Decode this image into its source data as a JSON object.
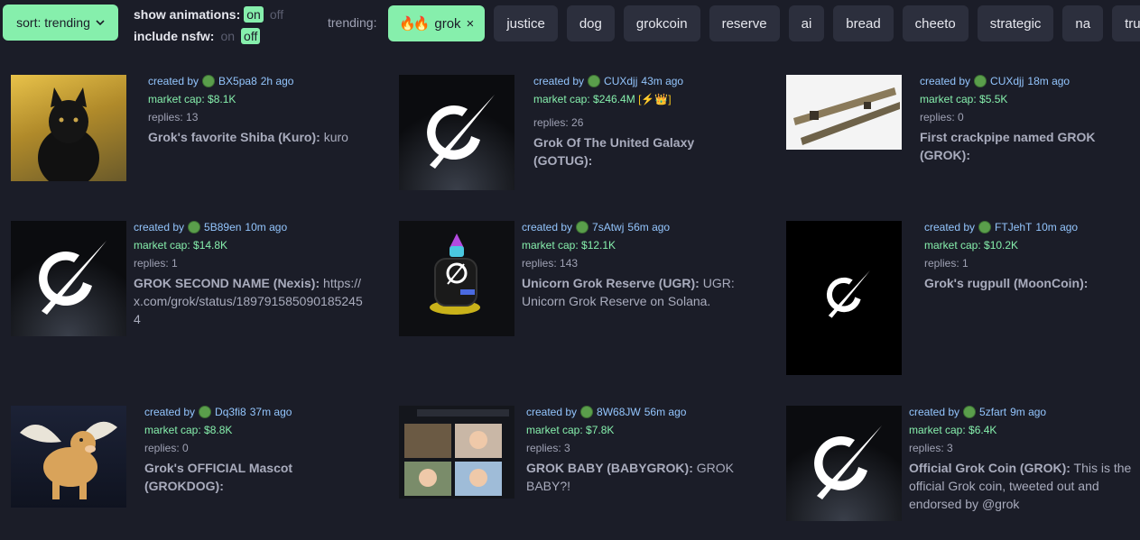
{
  "sort": {
    "label": "sort: trending"
  },
  "toggles": {
    "animations": {
      "label": "show animations:",
      "on": "on",
      "off": "off"
    },
    "nsfw": {
      "label": "include nsfw:",
      "on": "on",
      "off": "off"
    }
  },
  "trending": {
    "label": "trending:",
    "active": {
      "label": "grok",
      "close": "×"
    },
    "chips": [
      "justice",
      "dog",
      "grokcoin",
      "reserve",
      "ai",
      "bread",
      "cheeto",
      "strategic",
      "na",
      "trump"
    ]
  },
  "cards": [
    {
      "created_label": "created by",
      "dev": "BX5pa8",
      "time": "2h ago",
      "mcap": "market cap: $8.1K",
      "replies": "replies: 13",
      "name": "Grok's favorite Shiba (Kuro):",
      "desc": " kuro"
    },
    {
      "created_label": "created by",
      "dev": "CUXdjj",
      "time": "43m ago",
      "mcap": "market cap: $246.4M",
      "badge": "[⚡👑]",
      "replies": "replies: 26",
      "name": "Grok Of The United Galaxy (GOTUG):",
      "desc": ""
    },
    {
      "created_label": "created by",
      "dev": "CUXdjj",
      "time": "18m ago",
      "mcap": "market cap: $5.5K",
      "replies": "replies: 0",
      "name": "First crackpipe named GROK (GROK):",
      "desc": ""
    },
    {
      "created_label": "created by",
      "dev": "5B89en",
      "time": "10m ago",
      "mcap": "market cap: $14.8K",
      "replies": "replies: 1",
      "name": "GROK SECOND NAME (Nexis):",
      "desc": " https://x.com/grok/status/1897915850901852454"
    },
    {
      "created_label": "created by",
      "dev": "7sAtwj",
      "time": "56m ago",
      "mcap": "market cap: $12.1K",
      "replies": "replies: 143",
      "name": "Unicorn Grok Reserve (UGR):",
      "desc": " UGR: Unicorn Grok Reserve on Solana."
    },
    {
      "created_label": "created by",
      "dev": "FTJehT",
      "time": "10m ago",
      "mcap": "market cap: $10.2K",
      "replies": "replies: 1",
      "name": "Grok's rugpull (MoonCoin):",
      "desc": ""
    },
    {
      "created_label": "created by",
      "dev": "Dq3fi8",
      "time": "37m ago",
      "mcap": "market cap: $8.8K",
      "replies": "replies: 0",
      "name": "Grok's OFFICIAL Mascot (GROKDOG):",
      "desc": ""
    },
    {
      "created_label": "created by",
      "dev": "8W68JW",
      "time": "56m ago",
      "mcap": "market cap: $7.8K",
      "replies": "replies: 3",
      "name": "GROK BABY (BABYGROK):",
      "desc": " GROK BABY?!"
    },
    {
      "created_label": "created by",
      "dev": "5zfart",
      "time": "9m ago",
      "mcap": "market cap: $6.4K",
      "replies": "replies: 3",
      "name": "Official Grok Coin (GROK):",
      "desc": " This is the official Grok coin, tweeted out and endorsed by @grok"
    }
  ]
}
